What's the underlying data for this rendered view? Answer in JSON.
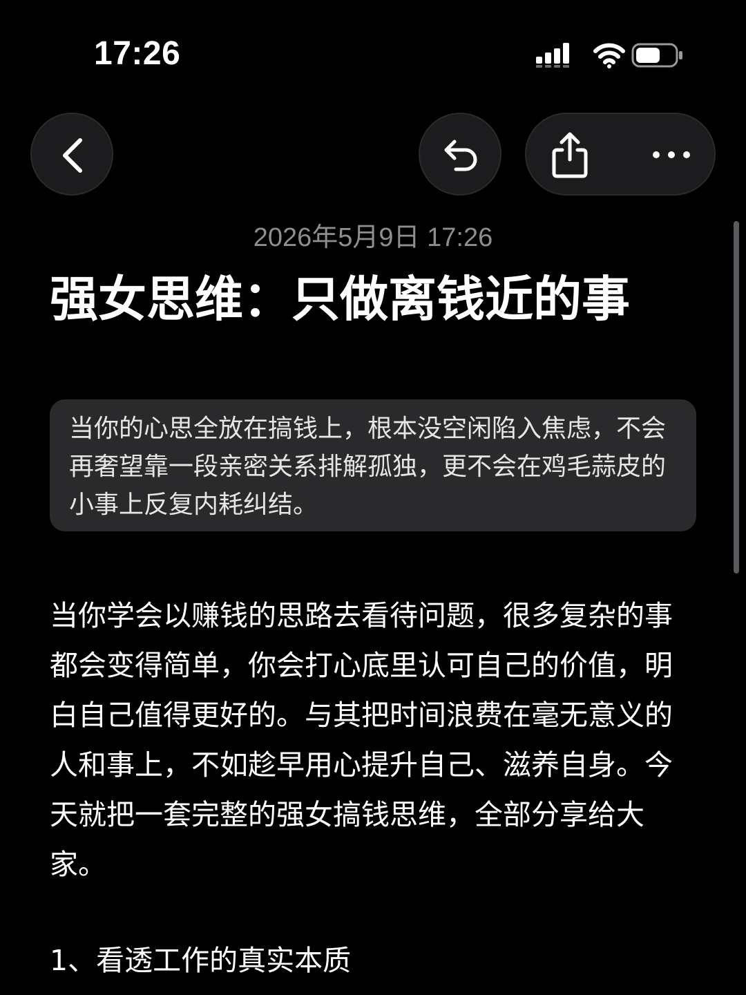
{
  "status_bar": {
    "time": "17:26",
    "icons": [
      "signal-icon",
      "wifi-icon",
      "battery-icon"
    ]
  },
  "toolbar": {
    "back_icon": "chevron-left-icon",
    "undo_icon": "undo-icon",
    "share_icon": "share-icon",
    "more_icon": "more-icon"
  },
  "note": {
    "date": "2026年5月9日 17:26",
    "title": "强女思维：只做离钱近的事",
    "quote": "当你的心思全放在搞钱上，根本没空闲陷入焦虑，不会再奢望靠一段亲密关系排解孤独，更不会在鸡毛蒜皮的小事上反复内耗纠结。",
    "body": "当你学会以赚钱的思路去看待问题，很多复杂的事都会变得简单，你会打心底里认可自己的价值，明白自己值得更好的。与其把时间浪费在毫无意义的人和事上，不如趁早用心提升自己、滋养自身。今天就把一套完整的强女搞钱思维，全部分享给大家。",
    "section_heading": "1、看透工作的真实本质"
  },
  "colors": {
    "background": "#000000",
    "button_bg": "#1c1c1e",
    "quote_bg": "#2a2a2c",
    "date_text": "#8d8d92"
  }
}
